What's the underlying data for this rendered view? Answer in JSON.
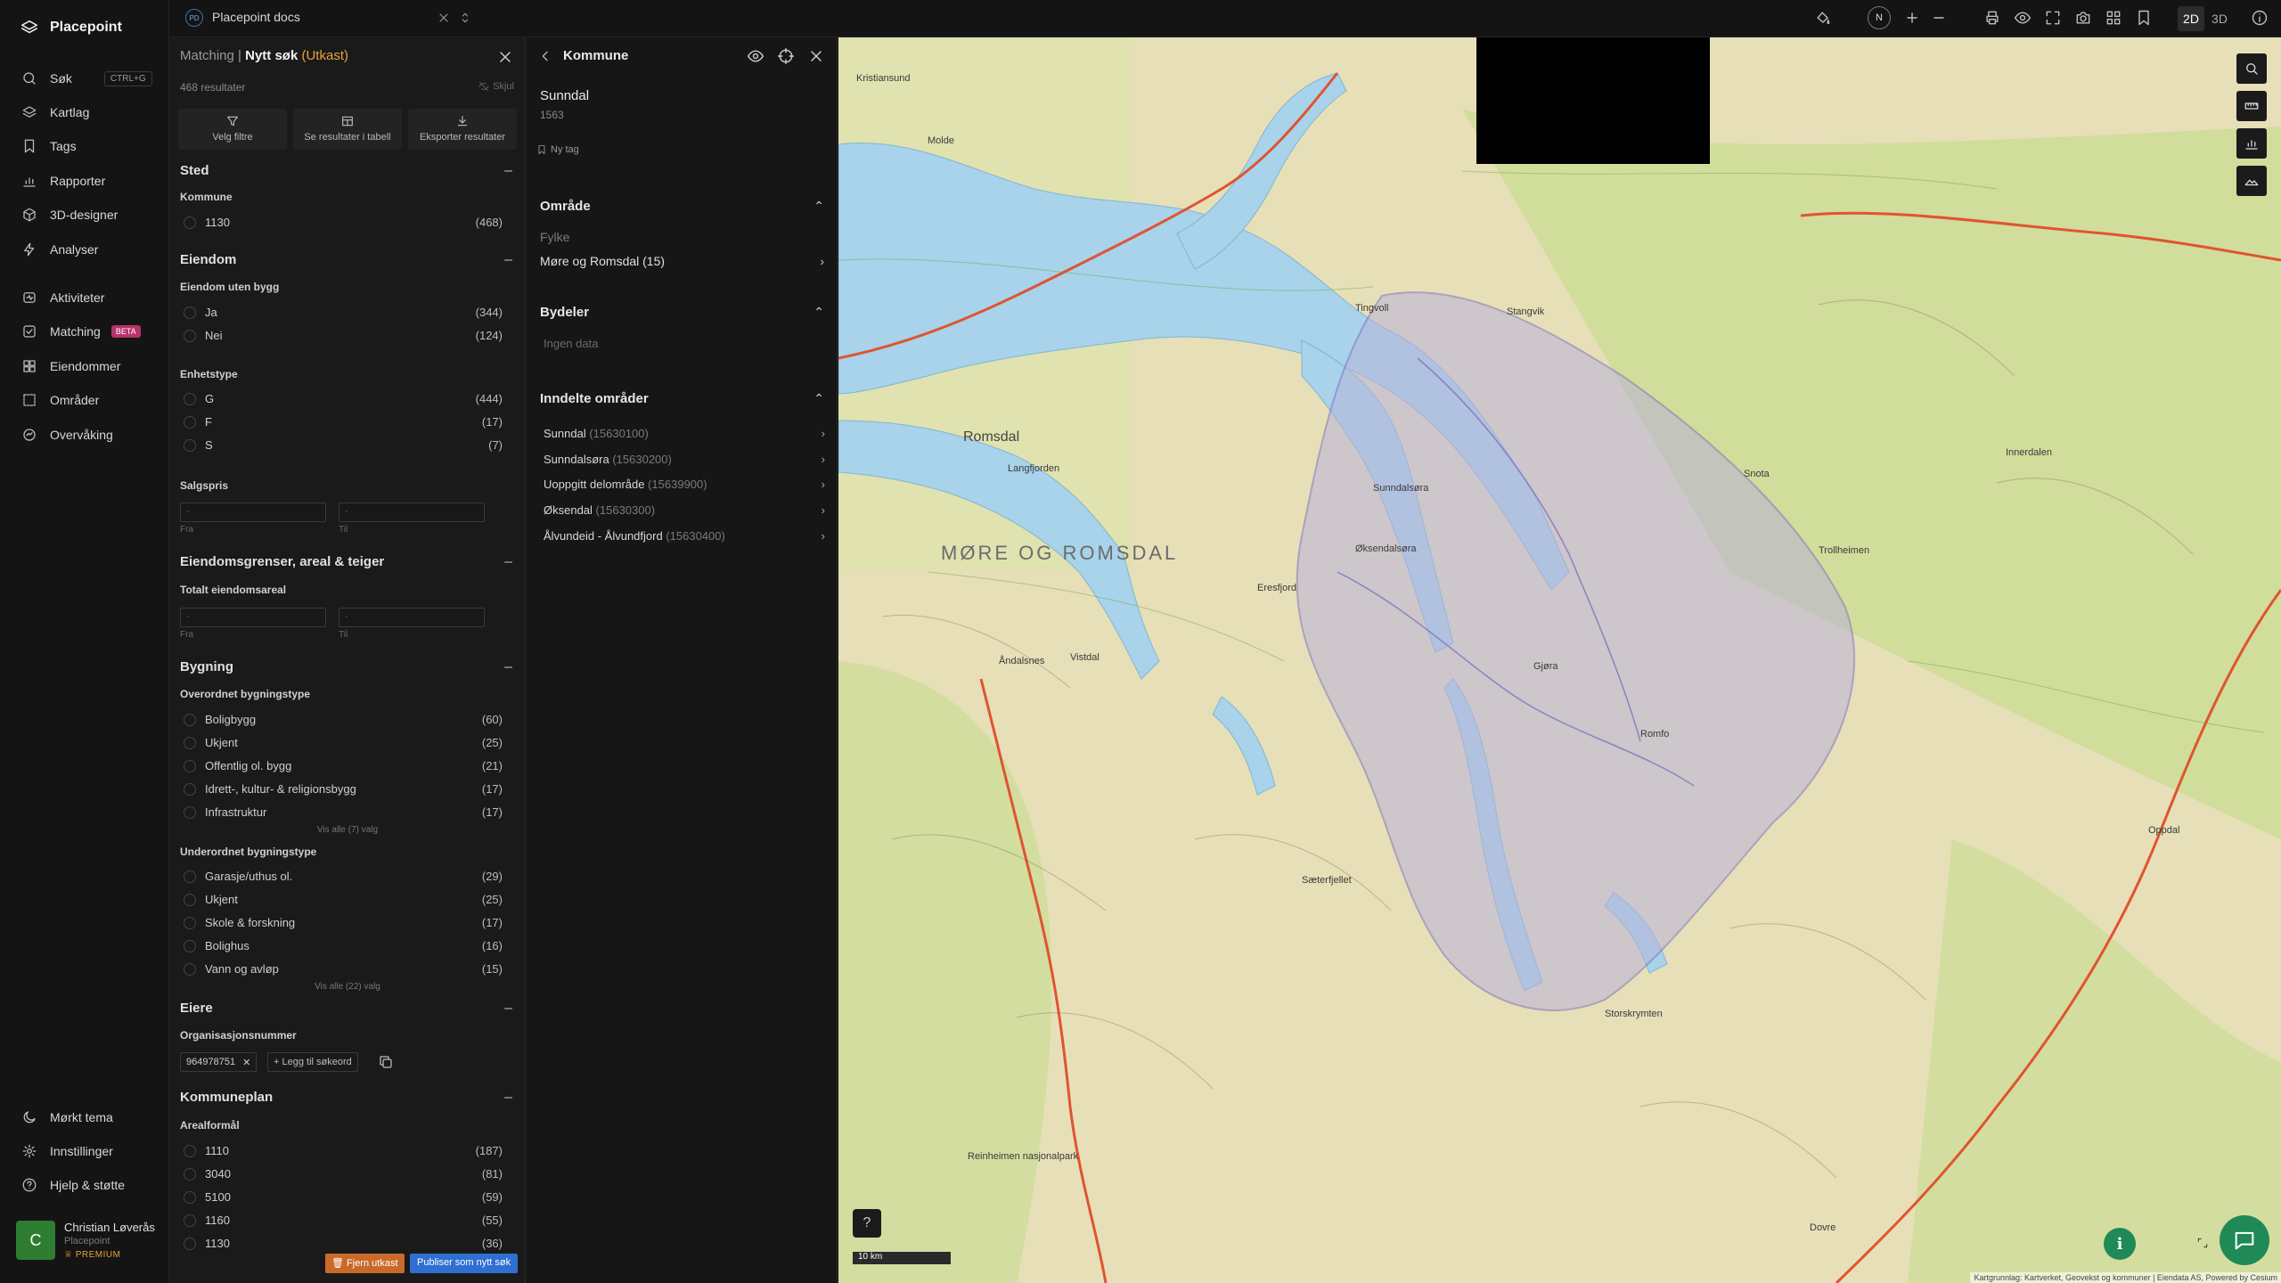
{
  "app": {
    "name": "Placepoint"
  },
  "nav": {
    "search": "Søk",
    "search_kbd": "CTRL+G",
    "layers": "Kartlag",
    "tags": "Tags",
    "reports": "Rapporter",
    "designer": "3D-designer",
    "analyses": "Analyser",
    "activities": "Aktiviteter",
    "matching": "Matching",
    "beta": "BETA",
    "properties": "Eiendommer",
    "areas": "Områder",
    "monitoring": "Overvåking",
    "dark_theme": "Mørkt tema",
    "settings": "Innstillinger",
    "help": "Hjelp & støtte"
  },
  "user": {
    "initial": "C",
    "name": "Christian Løverås",
    "org": "Placepoint",
    "plan": "PREMIUM"
  },
  "topbar": {
    "doc_badge": "PD",
    "doc_name": "Placepoint docs",
    "compass": "N",
    "mode_2d": "2D",
    "mode_3d": "3D"
  },
  "filter": {
    "title_prefix": "Matching",
    "separator": "|",
    "title": "Nytt søk",
    "draft": "(Utkast)",
    "result_count": "468 resultater",
    "hide": "Skjul",
    "actions": {
      "filters": "Velg filtre",
      "table": "Se resultater i tabell",
      "export": "Eksporter resultater"
    },
    "sted": {
      "title": "Sted",
      "kommune_label": "Kommune",
      "options": [
        {
          "label": "1130",
          "count": "(468)"
        }
      ]
    },
    "eiendom": {
      "title": "Eiendom",
      "uten_bygg": "Eiendom uten bygg",
      "uten_bygg_options": [
        {
          "label": "Ja",
          "count": "(344)"
        },
        {
          "label": "Nei",
          "count": "(124)"
        }
      ],
      "enhetstype": "Enhetstype",
      "enhetstype_options": [
        {
          "label": "G",
          "count": "(444)"
        },
        {
          "label": "F",
          "count": "(17)"
        },
        {
          "label": "S",
          "count": "(7)"
        }
      ],
      "salgspris": "Salgspris",
      "from_ph": "-",
      "to_ph": "-",
      "from": "Fra",
      "to": "Til"
    },
    "grenser": {
      "title": "Eiendomsgrenser, areal & teiger",
      "total": "Totalt eiendomsareal",
      "from_ph": "-",
      "to_ph": "-",
      "from": "Fra",
      "to": "Til"
    },
    "bygning": {
      "title": "Bygning",
      "overordnet": "Overordnet bygningstype",
      "overordnet_options": [
        {
          "label": "Boligbygg",
          "count": "(60)"
        },
        {
          "label": "Ukjent",
          "count": "(25)"
        },
        {
          "label": "Offentlig ol. bygg",
          "count": "(21)"
        },
        {
          "label": "Idrett-, kultur- & religionsbygg",
          "count": "(17)"
        },
        {
          "label": "Infrastruktur",
          "count": "(17)"
        }
      ],
      "overordnet_showall": "Vis alle (7) valg",
      "underordnet": "Underordnet bygningstype",
      "underordnet_options": [
        {
          "label": "Garasje/uthus ol.",
          "count": "(29)"
        },
        {
          "label": "Ukjent",
          "count": "(25)"
        },
        {
          "label": "Skole & forskning",
          "count": "(17)"
        },
        {
          "label": "Bolighus",
          "count": "(16)"
        },
        {
          "label": "Vann og avløp",
          "count": "(15)"
        }
      ],
      "underordnet_showall": "Vis alle (22) valg"
    },
    "eiere": {
      "title": "Eiere",
      "org_label": "Organisasjonsnummer",
      "chip": "964978751",
      "add": "Legg til søkeord"
    },
    "kommuneplan": {
      "title": "Kommuneplan",
      "areal": "Arealformål",
      "options": [
        {
          "label": "1110",
          "count": "(187)"
        },
        {
          "label": "3040",
          "count": "(81)"
        },
        {
          "label": "5100",
          "count": "(59)"
        },
        {
          "label": "1160",
          "count": "(55)"
        },
        {
          "label": "1130",
          "count": "(36)"
        }
      ]
    },
    "remove_draft": "Fjern utkast",
    "publish": "Publiser som nytt søk"
  },
  "detail": {
    "title": "Kommune",
    "name": "Sunndal",
    "number": "1563",
    "new_tag": "Ny tag",
    "omrade": {
      "title": "Område",
      "fylke_label": "Fylke",
      "fylke_value": "Møre og Romsdal (15)"
    },
    "bydeler": {
      "title": "Bydeler",
      "empty": "Ingen data"
    },
    "inndelte": {
      "title": "Inndelte områder",
      "items": [
        {
          "name": "Sunndal",
          "code": "(15630100)"
        },
        {
          "name": "Sunndalsøra",
          "code": "(15630200)"
        },
        {
          "name": "Uoppgitt delområde",
          "code": "(15639900)"
        },
        {
          "name": "Øksendal",
          "code": "(15630300)"
        },
        {
          "name": "Ålvundeid - Ålvundfjord",
          "code": "(15630400)"
        }
      ]
    }
  },
  "map": {
    "region_label": "MØRE OG ROMSDAL",
    "labels": [
      "Romsdal",
      "Langfjorden",
      "Eresfjord",
      "Sunndalsøra",
      "Øksendalsøra",
      "Gjøra",
      "Romfo",
      "Storskrymten",
      "Reinheimen nasjonalpark",
      "Snota",
      "Trollheimen",
      "Oppdal",
      "Dovre",
      "Innerdalen",
      "Stangvik",
      "Tingvoll",
      "Molde",
      "Vistdal",
      "Sæterfjellet",
      "Åndalsnes",
      "Kristiansund"
    ],
    "scale": "10 km",
    "attribution": "Kartgrunnlag: Kartverket, Geovekst og kommuner | Eiendata AS, Powered by Cesium",
    "colors": {
      "land": "#e7dfb8",
      "water": "#a8d3ea",
      "forest": "#c7dc8e",
      "polygon": "#b9b3d9"
    }
  },
  "colors": {
    "accent_green": "#1f8a57",
    "draft_orange": "#e8a53a",
    "publish_blue": "#2f6fd1",
    "beta_pink": "#b8326a"
  }
}
